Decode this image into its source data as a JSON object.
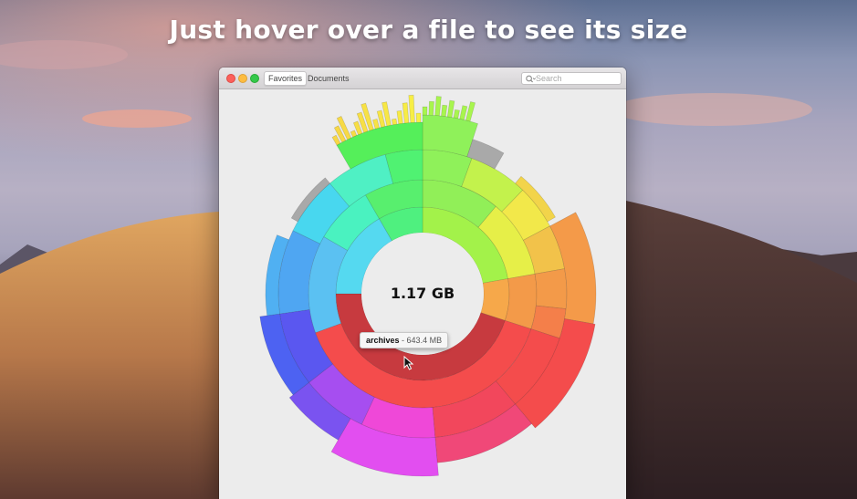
{
  "headline": "Just hover over a file to see its size",
  "window": {
    "tabs": [
      {
        "label": "Favorites",
        "active": true
      },
      {
        "label": "Documents",
        "active": false
      }
    ],
    "search": {
      "placeholder": "Search",
      "value": ""
    }
  },
  "disk": {
    "total_label": "1.17 GB",
    "tooltip": {
      "name": "archives",
      "size": "643.4 MB"
    }
  },
  "colors": {
    "archives": "#f44c4c",
    "archives_dark": "#c73a3f",
    "gray_tail": "#a9a9a9"
  }
}
